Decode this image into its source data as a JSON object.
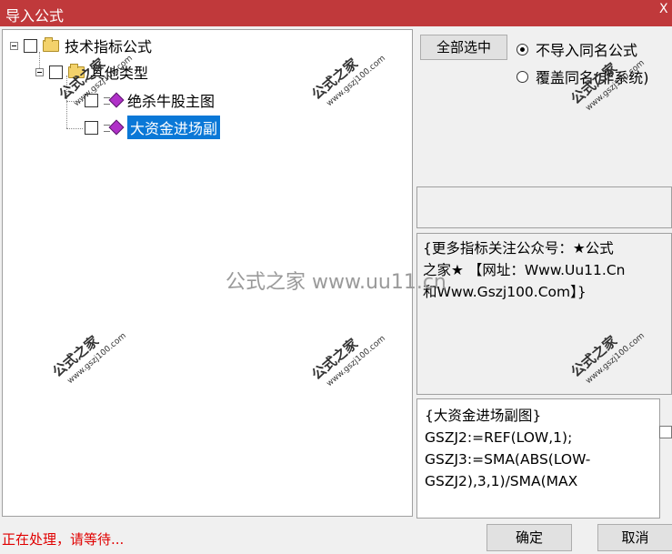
{
  "window": {
    "title": "导入公式",
    "close_glyph": "X"
  },
  "tree": {
    "root": {
      "label": "技术指标公式"
    },
    "group": {
      "label": "其他类型"
    },
    "items": [
      {
        "label": "绝杀牛股主图"
      },
      {
        "label": "大资金进场副"
      }
    ]
  },
  "options": {
    "select_all_label": "全部选中",
    "radios": [
      {
        "label": "不导入同名公式",
        "selected": true
      },
      {
        "label": "覆盖同名(非系统)",
        "selected": false
      }
    ]
  },
  "description_lines": [
    "{更多指标关注公众号：★公式",
    "之家★ 【网址：Www.Uu11.Cn",
    "和Www.Gszj100.Com】}"
  ],
  "code_lines": [
    "{大资金进场副图}",
    "GSZJ2:=REF(LOW,1);",
    "GSZJ3:=SMA(ABS(LOW-",
    "GSZJ2),3,1)/SMA(MAX"
  ],
  "status_text": "正在处理，请等待...",
  "buttons": {
    "ok_label": "确定",
    "cancel_label": "取消"
  },
  "watermark": {
    "brand": "公式之家",
    "site": "www.gszj100.com",
    "center_text": "公式之家 www.uu11.cn"
  },
  "colors": {
    "title_bar": "#c0393b",
    "selection": "#0a78d7",
    "status_text": "#e00000",
    "formula_icon": "#b030c8"
  }
}
